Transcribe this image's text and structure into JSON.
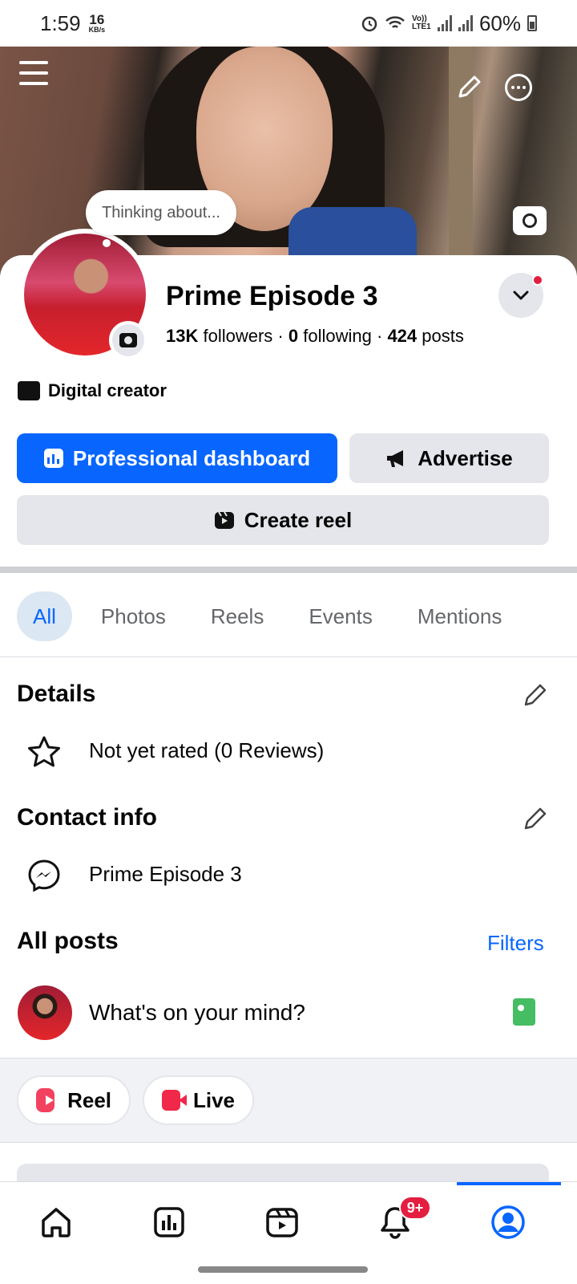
{
  "status_bar": {
    "time": "1:59",
    "speed_value": "16",
    "speed_unit": "KB/s",
    "volte_label": "Vo)) LTE1",
    "battery": "60%"
  },
  "cover": {
    "menu_icon": "hamburger-menu-icon",
    "edit_icon": "pencil-icon",
    "more_icon": "more-options-icon",
    "camera_icon": "camera-icon"
  },
  "profile": {
    "thought_bubble": "Thinking about...",
    "name": "Prime Episode 3",
    "followers_count": "13K",
    "followers_label": "followers",
    "following_count": "0",
    "following_label": "following",
    "posts_count": "424",
    "posts_label": "posts",
    "separator": "·",
    "category": "Digital creator",
    "notification_dot_color": "#e41e3f"
  },
  "actions": {
    "professional_dashboard": "Professional dashboard",
    "advertise": "Advertise",
    "create_reel": "Create reel",
    "primary_color": "#0866ff"
  },
  "tabs": [
    {
      "label": "All",
      "active": true
    },
    {
      "label": "Photos",
      "active": false
    },
    {
      "label": "Reels",
      "active": false
    },
    {
      "label": "Events",
      "active": false
    },
    {
      "label": "Mentions",
      "active": false
    }
  ],
  "details": {
    "title": "Details",
    "rating": "Not yet rated (0 Reviews)"
  },
  "contact": {
    "title": "Contact info",
    "messenger": "Prime Episode 3"
  },
  "posts": {
    "title": "All posts",
    "filters": "Filters",
    "composer_placeholder": "What's on your mind?",
    "reel_button": "Reel",
    "live_button": "Live"
  },
  "bottom_nav": {
    "items": [
      "home-icon",
      "dashboard-icon",
      "video-icon",
      "notifications-icon",
      "profile-icon"
    ],
    "notification_badge": "9+",
    "active": "profile-icon"
  }
}
